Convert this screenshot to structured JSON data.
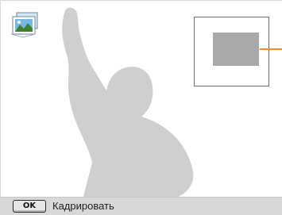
{
  "viewfinder": {
    "mode_icon": "landscape-photo-icon",
    "subject": "child-silhouette",
    "zoom_box": "crop-selection-box"
  },
  "bottom_bar": {
    "ok_key_label": "OK",
    "action_label": "Кадрировать"
  },
  "colors": {
    "silhouette": "#cfcfcf",
    "zoom_area": "#a9a9a9",
    "leader_line": "#f08c2d",
    "bottom_bar": "#d8d8d8"
  }
}
